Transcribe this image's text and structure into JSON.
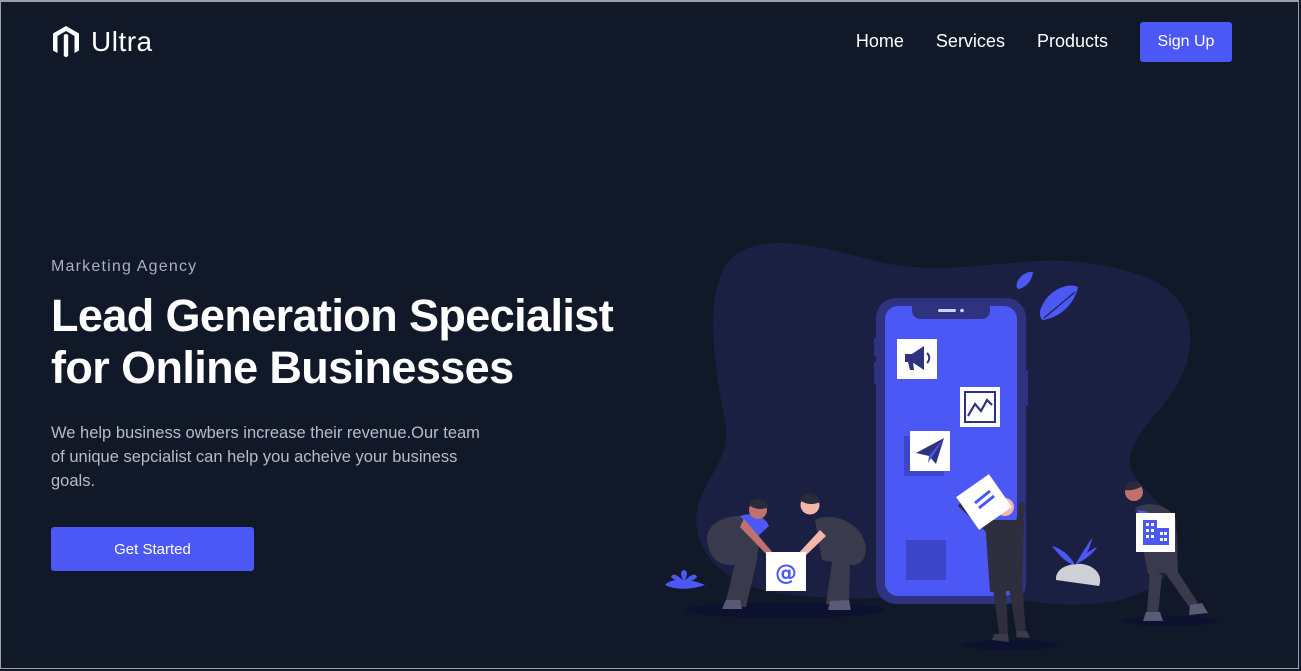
{
  "brand": {
    "name": "Ultra",
    "logo_icon": "hexagon-m-logo-icon"
  },
  "nav": {
    "links": [
      "Home",
      "Services",
      "Products"
    ],
    "signup_label": "Sign Up"
  },
  "hero": {
    "eyebrow": "Marketing Agency",
    "headline_line1": "Lead Generation Specialist",
    "headline_line2": "for Online Businesses",
    "description": "We help business owbers increase their revenue.Our team of unique sepcialist can help you acheive your business goals.",
    "cta_label": "Get Started",
    "illustration": {
      "phone_icons": [
        "megaphone-icon",
        "chart-icon",
        "paper-plane-icon",
        "document-icon"
      ],
      "card_icons": [
        "at-sign-icon",
        "building-icon"
      ]
    }
  },
  "colors": {
    "background": "#111827",
    "accent": "#4c58f5",
    "blob": "#1b2042",
    "muted_text": "#b7bcc8"
  }
}
